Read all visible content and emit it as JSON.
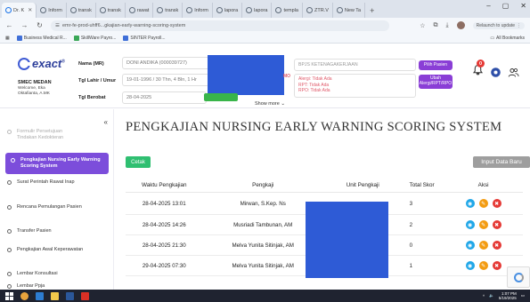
{
  "browser": {
    "tabs": [
      {
        "label": "Dr. K",
        "active": true
      },
      {
        "label": "Inform",
        "active": false
      },
      {
        "label": "transk",
        "active": false
      },
      {
        "label": "transk",
        "active": false
      },
      {
        "label": "rawat",
        "active": false
      },
      {
        "label": "transk",
        "active": false
      },
      {
        "label": "Inform",
        "active": false
      },
      {
        "label": "lapora",
        "active": false
      },
      {
        "label": "lapora",
        "active": false
      },
      {
        "label": "templa",
        "active": false
      },
      {
        "label": "ZTR.V",
        "active": false
      },
      {
        "label": "New Ta",
        "active": false
      }
    ],
    "new_tab": "+",
    "url": "emr-fe-prod-uhff6...gkajian-early-warning-scoring-system",
    "update_label": "Relaunch to update",
    "bookmarks": [
      {
        "label": "Business Medical R...",
        "color": "#3f6fd8"
      },
      {
        "label": "SkillWare Payro...",
        "color": "#3aa757"
      },
      {
        "label": "SINTER Payroll...",
        "color": "#3f6fd8"
      }
    ],
    "all_bookmarks": "All Bookmarks"
  },
  "header": {
    "logo_text": "exact",
    "logo_sup": "®",
    "user_name": "SMEC MEDAN",
    "user_welcome": "Welcome, Eka Oktafianta, A.MK",
    "labels": {
      "nama": "Nama (MR)",
      "tgl_lahir": "Tgl Lahir / Umur",
      "tgl_berobat": "Tgl Berobat"
    },
    "values": {
      "nama": "DONI ANDIKA (000039727)",
      "tgl_lahir": "19-01-1996 / 30 Thn, 4 Bln, 1 Hr",
      "tgl_berobat": "28-04-2025"
    },
    "bpjs_placeholder": "BPJS KETENAGAKERJAAN",
    "red_label": "MO",
    "allergy_lines": [
      "Alergi: Tidak Ada",
      "RPT: Tidak Ada",
      "RPO: Tidak Ada"
    ],
    "btn_pilih_pasien": "Pilih Pasien",
    "btn_ubah_alergi": "Ubah Alergi/RPT/RPO",
    "notif_count": "0",
    "show_more": "Show more"
  },
  "sidebar": {
    "items": [
      {
        "label": "Tindakan Kedokteran",
        "label_top": "Formulir Persetujuan",
        "state": "faded"
      },
      {
        "label": "Pengkajian Nursing Early Warning Scoring System",
        "state": "active"
      },
      {
        "label": "Surat Perintah Rawat Inap",
        "state": "normal"
      },
      {
        "label": "Rencana Pemulangan Pasien",
        "state": "normal"
      },
      {
        "label": "Transfer Pasien",
        "state": "normal"
      },
      {
        "label": "Pengkajian Awal Keperawatan",
        "state": "normal"
      },
      {
        "label": "Lembar Konsultasi",
        "state": "normal"
      },
      {
        "label": "Lembar Ppja",
        "state": "normal"
      }
    ]
  },
  "main": {
    "title": "PENGKAJIAN NURSING EARLY WARNING SCORING SYSTEM",
    "btn_cetak": "Cetak",
    "btn_input": "Input Data Baru",
    "columns": {
      "waktu": "Waktu Pengkajian",
      "pengkaji": "Pengkaji",
      "unit": "Unit Pengkaji",
      "skor": "Total Skor",
      "aksi": "Aksi"
    },
    "rows": [
      {
        "waktu": "28-04-2025 13:01",
        "pengkaji": "Mirwan, S.Kep. Ns",
        "skor": "3"
      },
      {
        "waktu": "28-04-2025 14:26",
        "pengkaji": "Musriadi Tambunan, AM",
        "skor": "2"
      },
      {
        "waktu": "28-04-2025 21:30",
        "pengkaji": "Melva Yunita Sitinjak, AM",
        "skor": "0"
      },
      {
        "waktu": "29-04-2025 07:30",
        "pengkaji": "Melva Yunita Sitinjak, AM",
        "skor": "1"
      }
    ]
  },
  "taskbar": {
    "time": "1:07 PM",
    "date": "5/19/2025"
  },
  "colors": {
    "accent_purple": "#7c4ddb",
    "green": "#2fbf71",
    "redaction_blue": "#2e5bd6"
  }
}
